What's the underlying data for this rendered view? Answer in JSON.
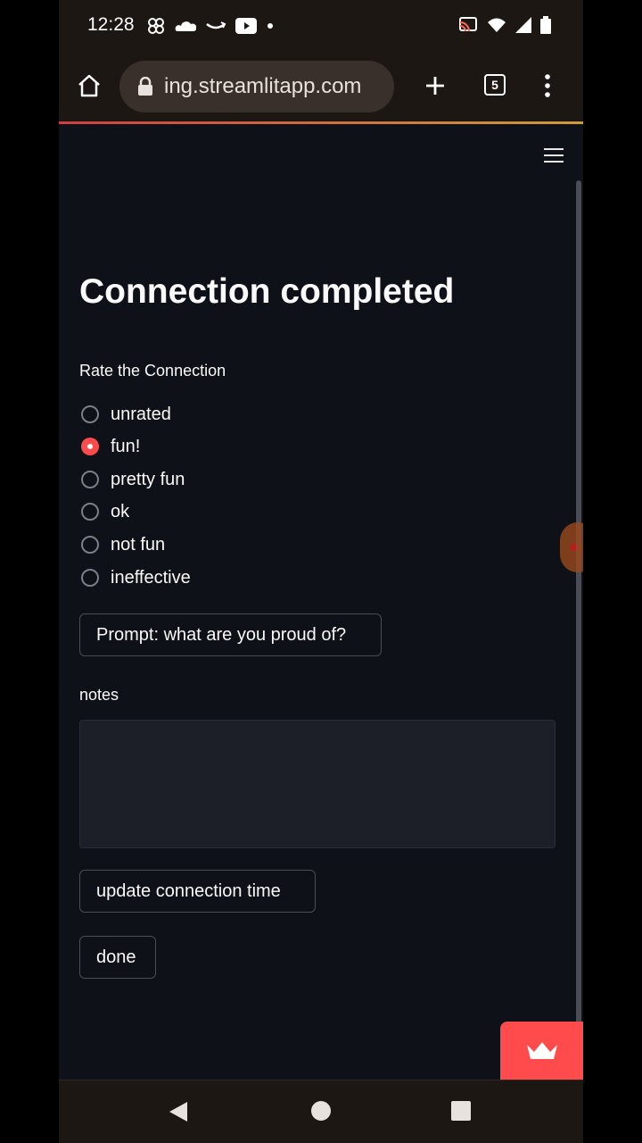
{
  "status_bar": {
    "time": "12:28",
    "icons_left": [
      "pinwheel-icon",
      "cloud-icon",
      "smile-arrow-icon",
      "youtube-icon",
      "dot-icon"
    ],
    "icons_right": [
      "cast-icon",
      "wifi-icon",
      "signal-icon",
      "battery-icon"
    ]
  },
  "browser": {
    "url": "ing.streamlitapp.com",
    "tab_count": "5"
  },
  "app": {
    "title": "Connection completed",
    "rating": {
      "label": "Rate the Connection",
      "options": [
        "unrated",
        "fun!",
        "pretty fun",
        "ok",
        "not fun",
        "ineffective"
      ],
      "selected": "fun!"
    },
    "prompt_button": "Prompt: what are you proud of?",
    "notes": {
      "label": "notes",
      "value": ""
    },
    "update_button": "update connection time",
    "done_button": "done"
  },
  "colors": {
    "accent": "#ff4b4b",
    "background": "#0e1117",
    "chrome": "#1d1714"
  }
}
